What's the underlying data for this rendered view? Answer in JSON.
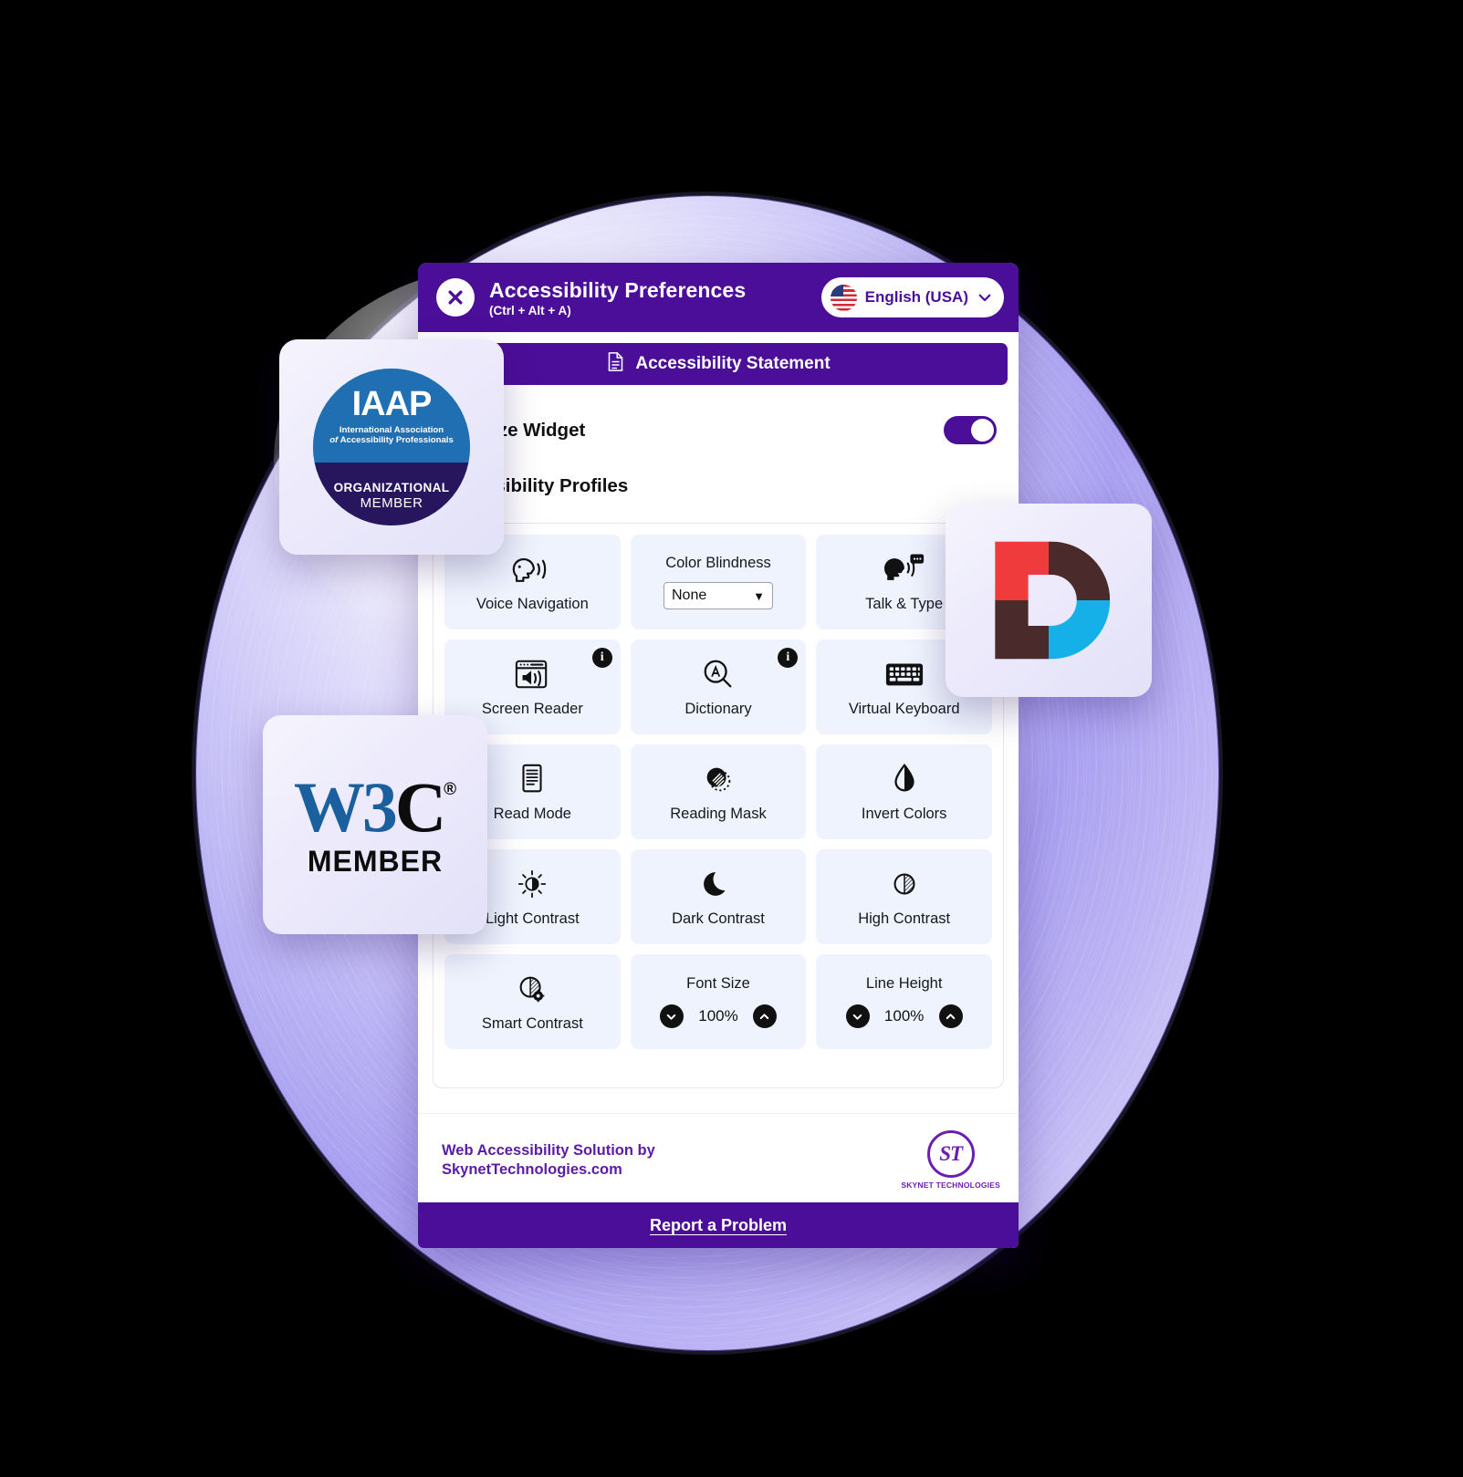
{
  "widget": {
    "header": {
      "close_icon": "close-x-icon",
      "title": "Accessibility Preferences",
      "shortcut": "(Ctrl + Alt + A)",
      "language": {
        "flag_icon": "usa-flag-icon",
        "label": "English (USA)",
        "chevron_icon": "chevron-down-icon"
      }
    },
    "statement_button": {
      "icon": "document-icon",
      "label": "Accessibility Statement"
    },
    "oversize_widget": {
      "label": "Oversize Widget",
      "toggle_state": "on"
    },
    "profiles_label": "Accessibility Profiles",
    "tiles": [
      {
        "name": "voice-navigation",
        "icon": "head-speaking-icon",
        "label": "Voice Navigation",
        "type": "toggle",
        "info": false
      },
      {
        "name": "color-blindness",
        "icon": "",
        "label": "Color Blindness",
        "type": "select",
        "value": "None",
        "info": false
      },
      {
        "name": "talk-and-type",
        "icon": "head-talk-type-icon",
        "label": "Talk & Type",
        "type": "toggle",
        "info": false
      },
      {
        "name": "screen-reader",
        "icon": "screen-reader-icon",
        "label": "Screen Reader",
        "type": "toggle",
        "info": true
      },
      {
        "name": "dictionary",
        "icon": "magnifier-a-icon",
        "label": "Dictionary",
        "type": "toggle",
        "info": true
      },
      {
        "name": "virtual-keyboard",
        "icon": "keyboard-icon",
        "label": "Virtual Keyboard",
        "type": "toggle",
        "info": true
      },
      {
        "name": "read-mode",
        "icon": "document-lines-icon",
        "label": "Read Mode",
        "type": "toggle",
        "info": false
      },
      {
        "name": "reading-mask",
        "icon": "reading-mask-icon",
        "label": "Reading Mask",
        "type": "toggle",
        "info": false
      },
      {
        "name": "invert-colors",
        "icon": "droplet-half-icon",
        "label": "Invert Colors",
        "type": "toggle",
        "info": false
      },
      {
        "name": "light-contrast",
        "icon": "sun-half-icon",
        "label": "Light Contrast",
        "type": "toggle",
        "info": false
      },
      {
        "name": "dark-contrast",
        "icon": "moon-icon",
        "label": "Dark Contrast",
        "type": "toggle",
        "info": false
      },
      {
        "name": "high-contrast",
        "icon": "circle-half-hatch-icon",
        "label": "High Contrast",
        "type": "toggle",
        "info": false
      },
      {
        "name": "smart-contrast",
        "icon": "circle-half-gear-icon",
        "label": "Smart Contrast",
        "type": "toggle",
        "info": false
      },
      {
        "name": "font-size",
        "icon": "",
        "label": "Font Size",
        "type": "stepper",
        "value": "100%",
        "info": false
      },
      {
        "name": "line-height",
        "icon": "",
        "label": "Line Height",
        "type": "stepper",
        "value": "100%",
        "info": false
      }
    ],
    "stepper_icons": {
      "decrease": "chevron-down-icon",
      "increase": "chevron-up-icon"
    },
    "footer": {
      "line1": "Web Accessibility Solution by",
      "line2": "SkynetTechnologies.com",
      "logo_mark": "ST",
      "logo_name": "SKYNET TECHNOLOGIES"
    },
    "report": {
      "label": "Report a Problem"
    }
  },
  "badges": {
    "iaap": {
      "acronym": "IAAP",
      "line1": "International Association",
      "line2_italic": "of",
      "line2": "Accessibility Professionals",
      "tier": "ORGANIZATIONAL",
      "member": "MEMBER"
    },
    "w3c": {
      "mark_blue": "W3",
      "mark_dark": "C",
      "registered": "®",
      "label": "MEMBER"
    },
    "dlogo": {
      "name": "d-letter-logo",
      "color_top_left": "#ef3b3b",
      "color_top_right": "#4a2a2a",
      "color_bottom_left": "#4a2a2a",
      "color_bottom_right": "#16b0e8"
    }
  },
  "colors": {
    "brand_purple": "#4b0e98",
    "footer_purple": "#5b1ba6",
    "tile_bg": "#eef3fd",
    "blob": "#a99ff0"
  }
}
